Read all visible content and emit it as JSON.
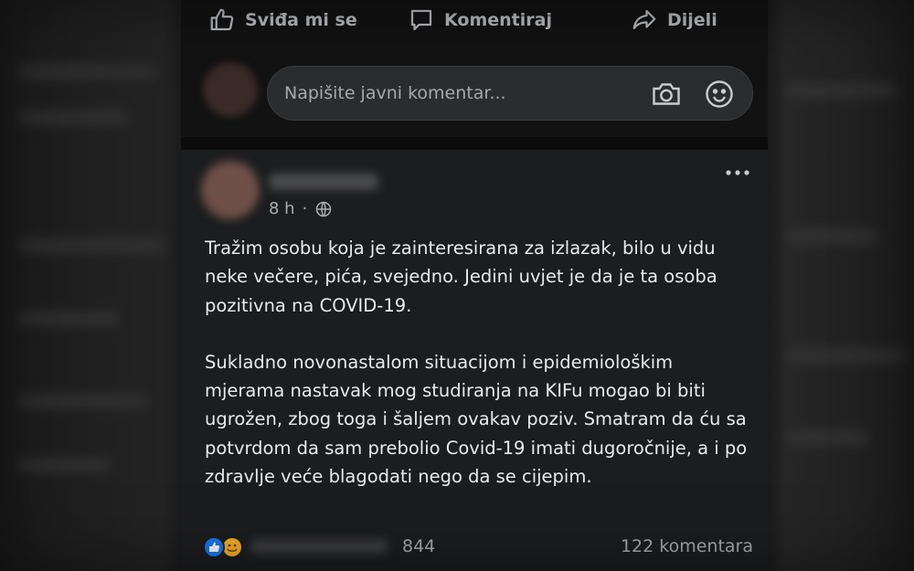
{
  "actions": {
    "like_label": "Sviđa mi se",
    "comment_label": "Komentiraj",
    "share_label": "Dijeli"
  },
  "comment_input": {
    "placeholder": "Napišite javni komentar..."
  },
  "post": {
    "time": "8 h",
    "paragraphs": [
      "Tražim osobu koja je zainteresirana za izlazak, bilo u vidu neke večere, pića, svejedno. Jedini uvjet je da je ta osoba pozitivna na COVID-19.",
      "Sukladno novonastalom situacijom i epidemiološkim mjerama nastavak mog studiranja na KIFu mogao bi biti ugrožen, zbog toga i šaljem ovakav poziv. Smatram da ću sa potvrdom da sam prebolio Covid-19 imati dugoročnije, a i po zdravlje veće blagodati nego da se cijepim."
    ],
    "reaction_count": "844",
    "comment_count": "122 komentara"
  },
  "icons": {
    "like": "thumbs-up-icon",
    "comment": "speech-bubble-icon",
    "share": "share-arrow-icon",
    "camera": "camera-icon",
    "emoji": "smiley-icon",
    "globe": "globe-icon",
    "more": "more-dots-icon"
  },
  "colors": {
    "background": "#121212",
    "post_bg": "#1c1d1f",
    "like_blue": "#1877f2",
    "haha_yellow": "#f7b125"
  }
}
